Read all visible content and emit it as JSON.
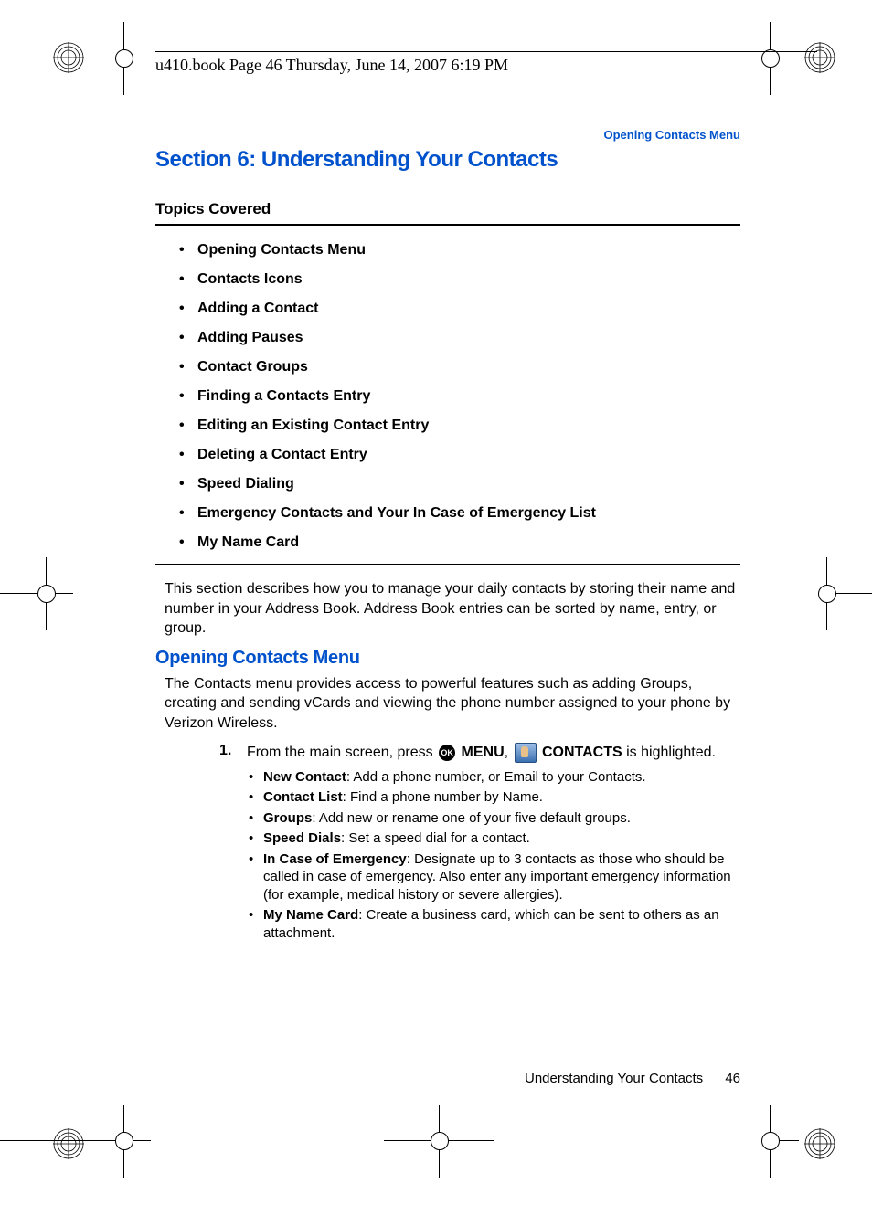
{
  "print_header": "u410.book  Page 46  Thursday, June 14, 2007  6:19 PM",
  "running_head": "Opening Contacts Menu",
  "section_title": "Section 6: Understanding Your Contacts",
  "topics_label": "Topics Covered",
  "topics": [
    "Opening Contacts Menu",
    "Contacts Icons",
    "Adding a Contact",
    "Adding Pauses",
    "Contact Groups",
    "Finding a Contacts Entry",
    "Editing an Existing Contact Entry",
    "Deleting a Contact Entry",
    "Speed Dialing",
    "Emergency Contacts and Your In Case of Emergency List",
    "My Name Card"
  ],
  "intro": "This section describes how you to manage your daily contacts by storing their name and number in your Address Book. Address Book entries can be sorted by name, entry, or group.",
  "subhead": "Opening Contacts Menu",
  "sub_intro": "The Contacts menu provides access to powerful features such as adding Groups, creating and sending vCards and viewing the phone number assigned to your phone by Verizon Wireless.",
  "step": {
    "num": "1.",
    "pre": "From the main screen, press ",
    "menu": " MENU",
    "sep": ", ",
    "contacts": " CONTACTS",
    "post": " is highlighted."
  },
  "bullets": [
    {
      "b": "New Contact",
      "t": ": Add a phone number, or Email to your Contacts."
    },
    {
      "b": "Contact List",
      "t": ": Find a phone number by Name."
    },
    {
      "b": "Groups",
      "t": ": Add new or rename one of your five default groups."
    },
    {
      "b": "Speed Dials",
      "t": ": Set a speed dial for a contact."
    },
    {
      "b": "In Case of Emergency",
      "t": ": Designate up to 3 contacts as those who should be called in case of emergency. Also enter any important emergency information (for example, medical history or severe allergies)."
    },
    {
      "b": "My Name Card",
      "t": ": Create a business card, which can be sent to others as an attachment."
    }
  ],
  "footer_text": "Understanding Your Contacts",
  "footer_page": "46"
}
